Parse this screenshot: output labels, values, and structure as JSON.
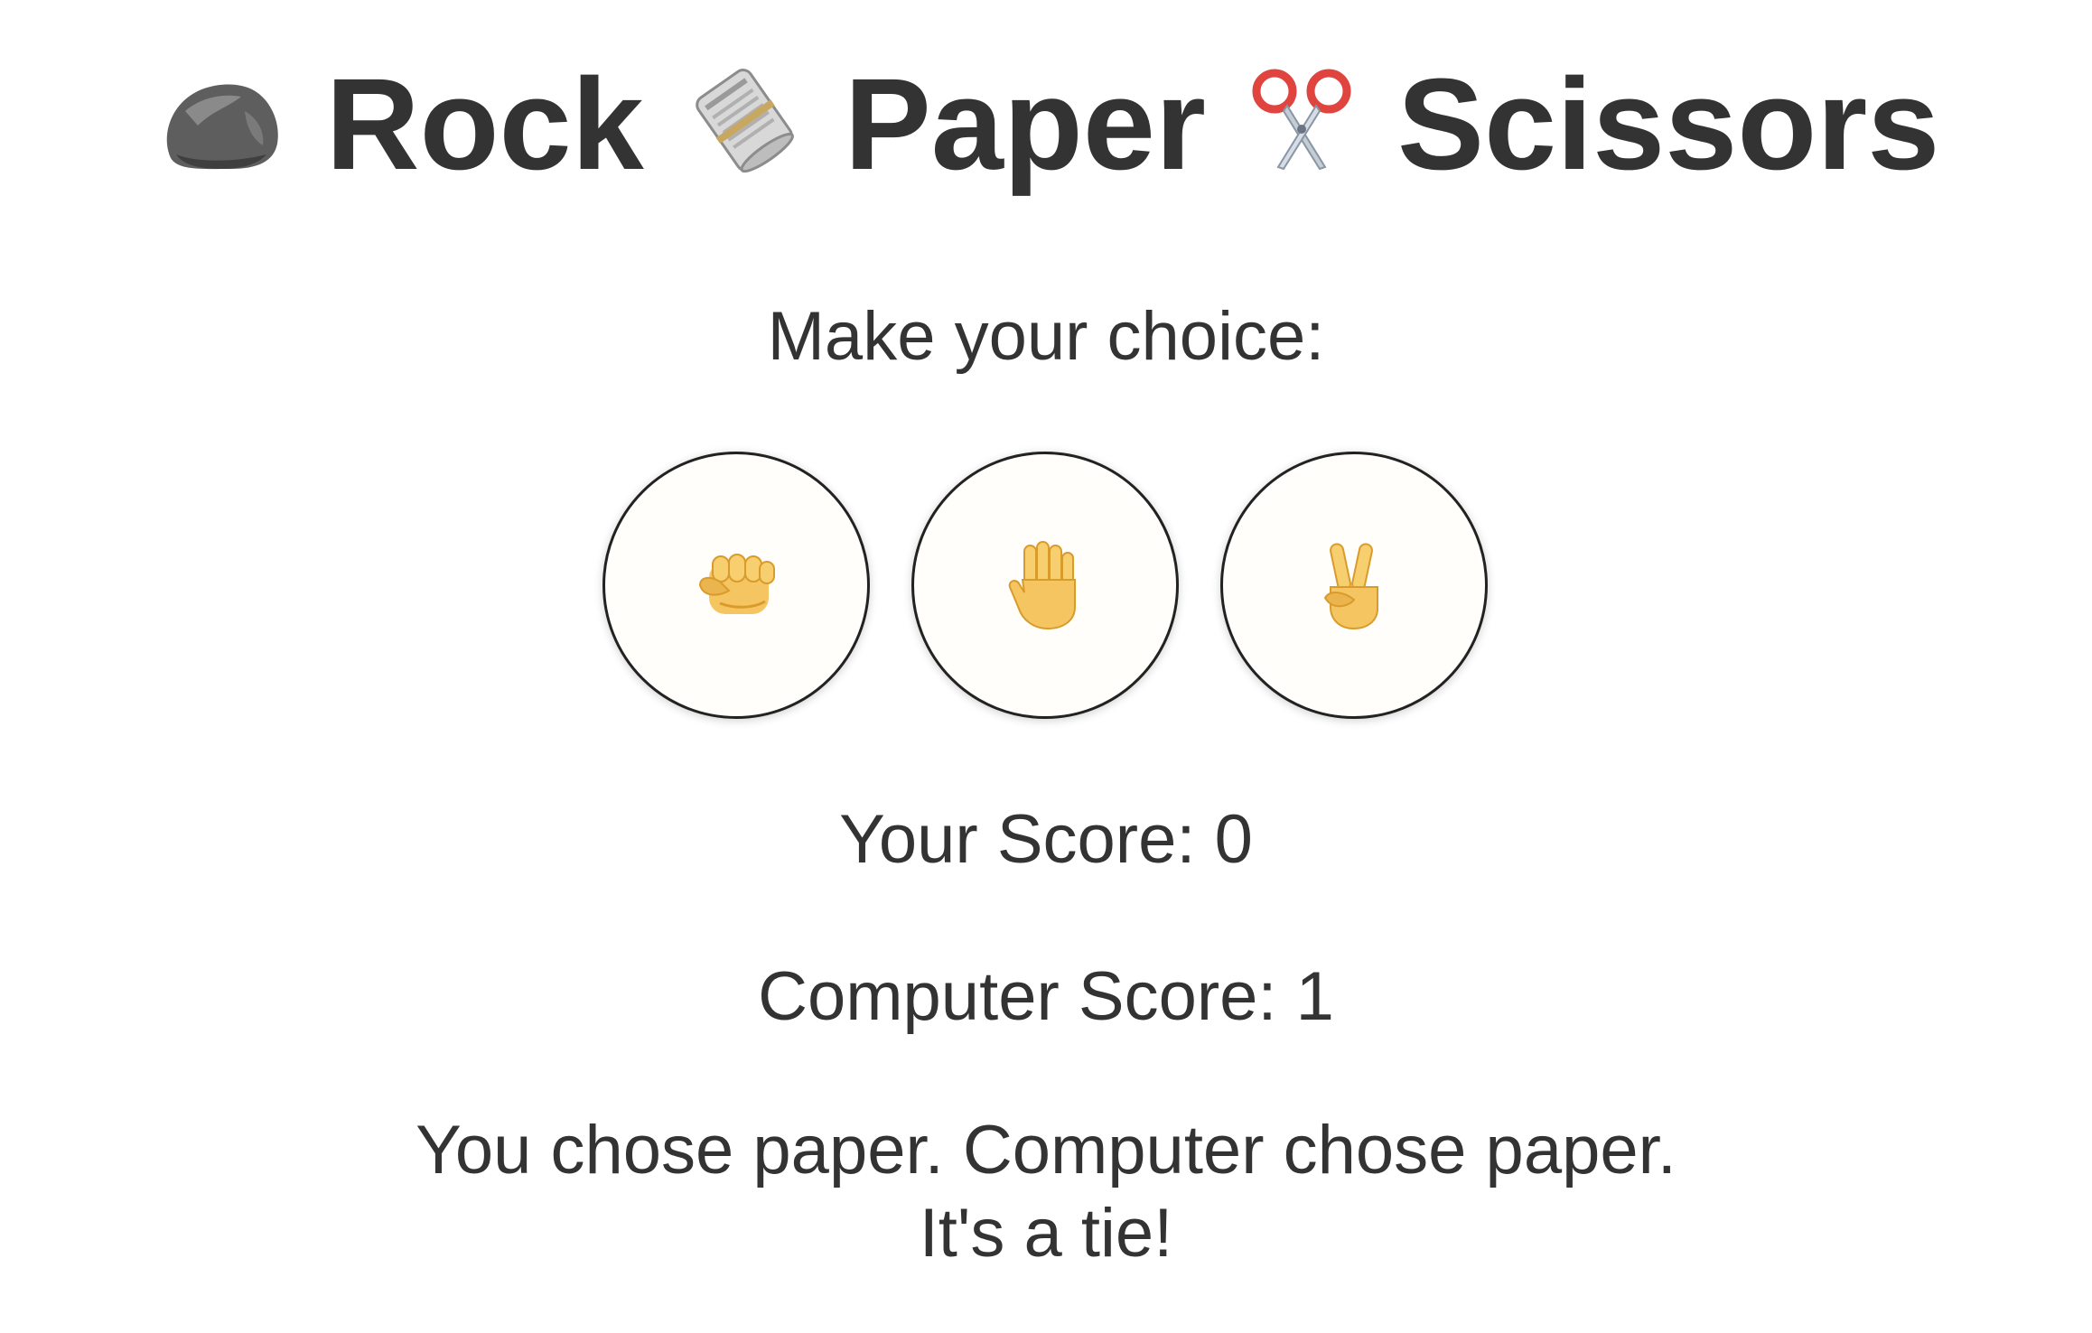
{
  "title": {
    "rock_label": "Rock",
    "paper_label": "Paper",
    "scissors_label": "Scissors",
    "icons": [
      "rock-icon",
      "newspaper-icon",
      "scissors-icon"
    ]
  },
  "prompt": "Make your choice:",
  "choices": [
    {
      "value": "rock",
      "icon": "fist-icon"
    },
    {
      "value": "paper",
      "icon": "raised-hand-icon"
    },
    {
      "value": "scissors",
      "icon": "victory-hand-icon"
    }
  ],
  "scores": {
    "player_text": "Your Score: 0",
    "computer_text": "Computer Score: 1",
    "player": 0,
    "computer": 1
  },
  "result": {
    "line1": "You chose paper. Computer chose paper.",
    "line2": "It's a tie!"
  },
  "colors": {
    "text": "#333333",
    "button_bg": "#fffefa",
    "button_border": "#222222",
    "skin": "#f4c561"
  }
}
